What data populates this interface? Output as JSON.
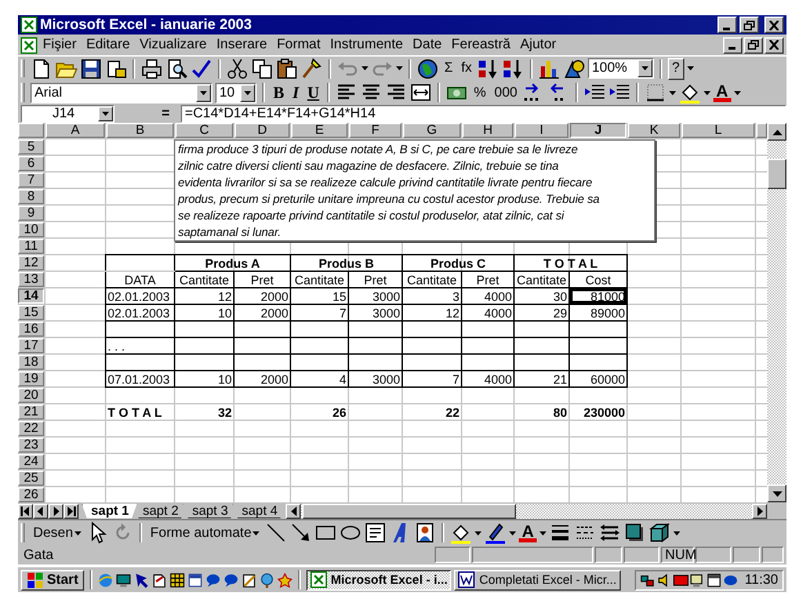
{
  "window": {
    "title": "Microsoft Excel - ianuarie 2003"
  },
  "menu": [
    {
      "label": "Fişier"
    },
    {
      "label": "Editare"
    },
    {
      "label": "Vizualizare"
    },
    {
      "label": "Inserare"
    },
    {
      "label": "Format"
    },
    {
      "label": "Instrumente"
    },
    {
      "label": "Date"
    },
    {
      "label": "Fereastră"
    },
    {
      "label": "Ajutor"
    }
  ],
  "standard_toolbar": {
    "sum": "Σ",
    "function": "fx",
    "zoom": "100%",
    "help": "?"
  },
  "formatting_toolbar": {
    "font": "Arial",
    "size": "10",
    "bold": "B",
    "italic": "I",
    "underline": "U",
    "percent": "%",
    "thousands": "000",
    "font_color": "A"
  },
  "formula_bar": {
    "name_box": "J14",
    "equals": "=",
    "formula": "=C14*D14+E14*F14+G14*H14"
  },
  "columns": [
    {
      "label": "A",
      "selected": false
    },
    {
      "label": "B",
      "selected": false
    },
    {
      "label": "C",
      "selected": false
    },
    {
      "label": "D",
      "selected": false
    },
    {
      "label": "E",
      "selected": false
    },
    {
      "label": "F",
      "selected": false
    },
    {
      "label": "G",
      "selected": false
    },
    {
      "label": "H",
      "selected": false
    },
    {
      "label": "I",
      "selected": false
    },
    {
      "label": "J",
      "selected": true
    },
    {
      "label": "K",
      "selected": false
    },
    {
      "label": "L",
      "selected": false
    }
  ],
  "text_box": {
    "lines": [
      "firma produce 3 tipuri de produse notate A, B si C, pe care trebuie sa le livreze",
      "zilnic catre diversi clienti sau magazine de desfacere. Zilnic, trebuie se tina",
      "evidenta livrarilor si sa se realizeze calcule privind cantitatile livrate pentru fiecare",
      "produs, precum si preturile unitare impreuna cu costul acestor produse. Trebuie sa",
      "se realizeze rapoarte privind cantitatile si costul produselor, atat zilnic, cat si",
      "saptamanal si lunar."
    ]
  },
  "rows": [
    {
      "number": "5",
      "kind": "plain",
      "selected": false
    },
    {
      "number": "6",
      "kind": "plain",
      "selected": false
    },
    {
      "number": "7",
      "kind": "plain",
      "selected": false
    },
    {
      "number": "8",
      "kind": "plain",
      "selected": false
    },
    {
      "number": "9",
      "kind": "plain",
      "selected": false
    },
    {
      "number": "10",
      "kind": "plain",
      "selected": false
    },
    {
      "number": "11",
      "kind": "plain",
      "selected": false
    },
    {
      "number": "12",
      "kind": "group_header",
      "selected": false,
      "cells": [
        null,
        null,
        "Produs A",
        null,
        "Produs B",
        null,
        "Produs C",
        null,
        "T O T A L"
      ]
    },
    {
      "number": "13",
      "kind": "column_header",
      "selected": false,
      "cells": [
        null,
        "DATA",
        "Cantitate",
        "Pret",
        "Cantitate",
        "Pret",
        "Cantitate",
        "Pret",
        "Cantitate",
        "Cost"
      ]
    },
    {
      "number": "14",
      "kind": "data",
      "selected": true,
      "cells": [
        null,
        "02.01.2003",
        "12",
        "2000",
        "15",
        "3000",
        "3",
        "4000",
        "30",
        "81000"
      ]
    },
    {
      "number": "15",
      "kind": "data",
      "selected": false,
      "cells": [
        null,
        "02.01.2003",
        "10",
        "2000",
        "7",
        "3000",
        "12",
        "4000",
        "29",
        "89000"
      ]
    },
    {
      "number": "16",
      "kind": "data",
      "selected": false
    },
    {
      "number": "17",
      "kind": "data",
      "selected": false,
      "cells": [
        null,
        ". . ."
      ]
    },
    {
      "number": "18",
      "kind": "data",
      "selected": false
    },
    {
      "number": "19",
      "kind": "data",
      "selected": false,
      "cells": [
        null,
        "07.01.2003",
        "10",
        "2000",
        "4",
        "3000",
        "7",
        "4000",
        "21",
        "60000"
      ]
    },
    {
      "number": "20",
      "kind": "plain",
      "selected": false
    },
    {
      "number": "21",
      "kind": "total",
      "selected": false,
      "cells": [
        null,
        "T O T A L",
        "32",
        null,
        "26",
        null,
        "22",
        null,
        "80",
        "230000"
      ]
    },
    {
      "number": "22",
      "kind": "plain",
      "selected": false
    },
    {
      "number": "23",
      "kind": "plain",
      "selected": false
    },
    {
      "number": "24",
      "kind": "plain",
      "selected": false
    },
    {
      "number": "25",
      "kind": "plain",
      "selected": false
    },
    {
      "number": "26",
      "kind": "plain",
      "selected": false
    }
  ],
  "sheet_tabs": [
    {
      "label": "sapt 1",
      "selected": true
    },
    {
      "label": "sapt 2",
      "selected": false
    },
    {
      "label": "sapt 3",
      "selected": false
    },
    {
      "label": "sapt 4",
      "selected": false
    }
  ],
  "drawing_toolbar": {
    "draw": "Desen",
    "autoshapes": "Forme automate",
    "font_color": "A"
  },
  "status_bar": {
    "status": "Gata",
    "indicator": "NUM"
  },
  "taskbar": {
    "start": "Start",
    "tasks": [
      {
        "label": "Microsoft Excel - i...",
        "selected": true
      },
      {
        "label": "Completati Excel - Micr...",
        "selected": false
      }
    ],
    "clock": "11:30"
  }
}
